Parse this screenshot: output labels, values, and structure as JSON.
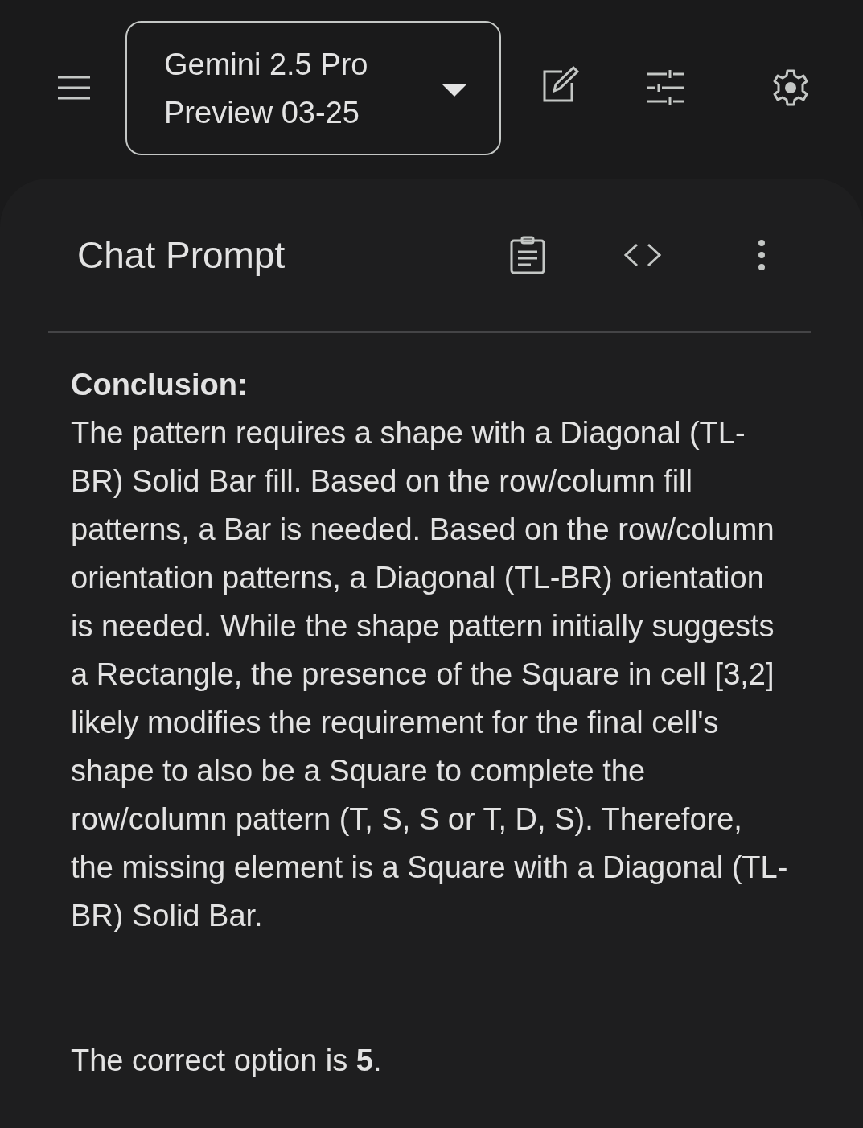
{
  "model_selector": {
    "label_lines": [
      "Gemini 2.5 Pro",
      "Preview 03-25"
    ]
  },
  "panel": {
    "title": "Chat Prompt"
  },
  "response": {
    "heading": "Conclusion:",
    "paragraphs": [
      "The pattern requires a shape with a Diagonal (TL-BR) Solid Bar fill. Based on the row/column fill patterns, a Bar is needed. Based on the row/column orientation patterns, a Diagonal (TL-BR) orientation is needed. While the shape pattern initially suggests a Rectangle, the presence of the Square in cell [3,2] likely modifies the requirement for the final cell's shape to also be a Square to complete the row/column pattern (T, S, S or T, D, S). Therefore, the missing element is a Square with a Diagonal (TL-BR) Solid Bar.",
      "The correct option is **5**."
    ]
  }
}
